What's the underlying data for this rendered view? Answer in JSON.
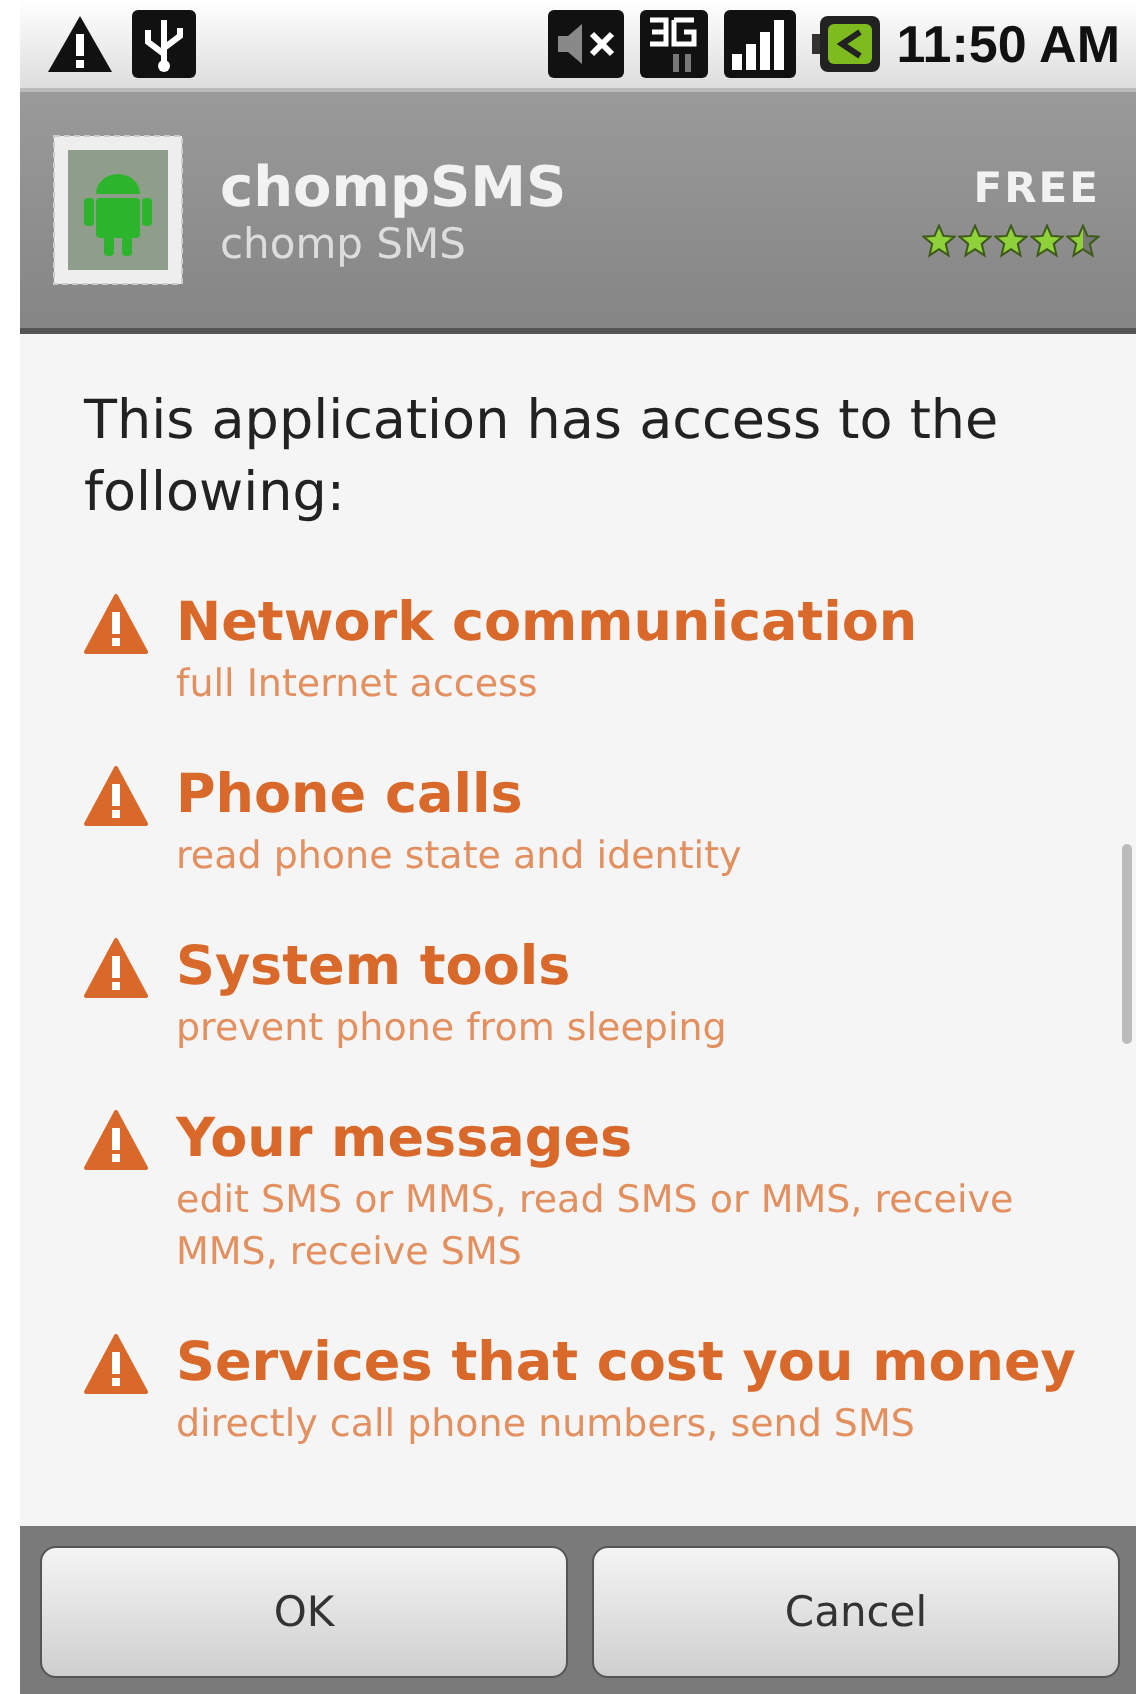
{
  "status_bar": {
    "time": "11:50 AM"
  },
  "app": {
    "name": "chompSMS",
    "developer": "chomp SMS",
    "price": "FREE",
    "stars": 4.5
  },
  "intro": "This application has access to the following:",
  "permissions": [
    {
      "title": "Network communication",
      "detail": "full Internet access"
    },
    {
      "title": "Phone calls",
      "detail": "read phone state and identity"
    },
    {
      "title": "System tools",
      "detail": "prevent phone from sleeping"
    },
    {
      "title": "Your messages",
      "detail": "edit SMS or MMS, read SMS or MMS, receive MMS, receive SMS"
    },
    {
      "title": "Services that cost you money",
      "detail": "directly call phone numbers, send SMS"
    }
  ],
  "buttons": [
    "OK",
    "Cancel"
  ]
}
